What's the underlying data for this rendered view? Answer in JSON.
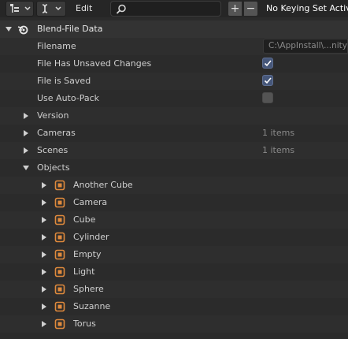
{
  "header": {
    "edit_label": "Edit",
    "search": {
      "value": ""
    },
    "plus_label": "+",
    "minus_label": "−",
    "keying_set": "No Keying Set Active"
  },
  "tree": {
    "root_label": "Blend-File Data",
    "properties": [
      {
        "label": "Filename",
        "value": "C:\\AppInstall\\...nity_"
      },
      {
        "label": "File Has Unsaved Changes",
        "checked": true
      },
      {
        "label": "File is Saved",
        "checked": true
      },
      {
        "label": "Use Auto-Pack",
        "checked": false
      }
    ],
    "groups": [
      {
        "label": "Version",
        "count": ""
      },
      {
        "label": "Cameras",
        "count": "1 items"
      },
      {
        "label": "Scenes",
        "count": "1 items"
      },
      {
        "label": "Objects",
        "count": ""
      }
    ],
    "objects": [
      "Another Cube",
      "Camera",
      "Cube",
      "Cylinder",
      "Empty",
      "Light",
      "Sphere",
      "Suzanne",
      "Torus"
    ]
  },
  "colors": {
    "object_icon": "#e08a3c",
    "checkbox_on": "#46577a"
  }
}
